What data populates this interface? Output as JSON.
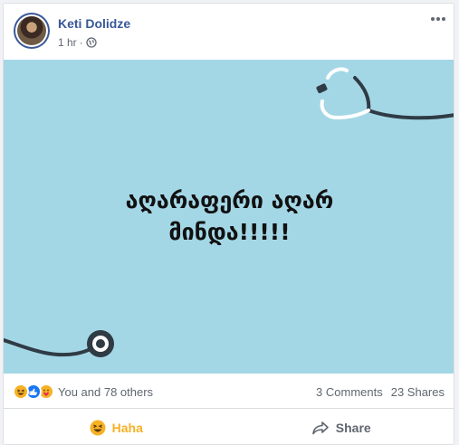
{
  "post": {
    "author": "Keti Dolidze",
    "time": "1 hr",
    "separator": "·",
    "privacy_icon": "globe-icon",
    "menu_icon": "more-horizontal-icon",
    "text_line1": "აღარაფერი აღარ",
    "text_line2": "მინდა!!!!!",
    "image_bg": "#a4d7e6"
  },
  "stats": {
    "reaction_icons": [
      "haha-icon",
      "like-icon",
      "care-icon"
    ],
    "reactions_label": "You and 78 others",
    "comments": "3 Comments",
    "shares": "23 Shares"
  },
  "actions": {
    "reaction_label": "Haha",
    "reaction_color": "#f7b125",
    "share_label": "Share"
  }
}
